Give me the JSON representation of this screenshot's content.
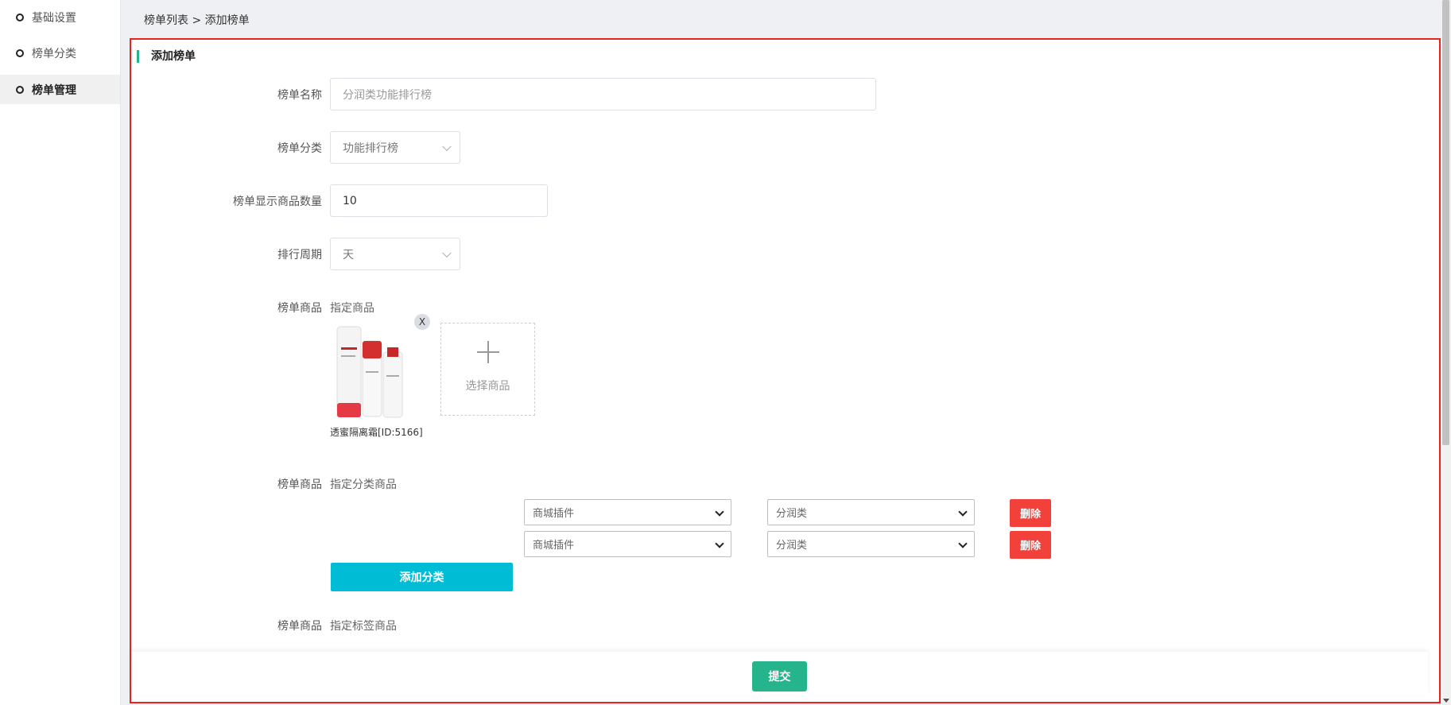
{
  "sidebar": {
    "items": [
      {
        "label": "基础设置",
        "active": false
      },
      {
        "label": "榜单分类",
        "active": false
      },
      {
        "label": "榜单管理",
        "active": true
      }
    ]
  },
  "breadcrumb": {
    "parent": "榜单列表",
    "separator": " > ",
    "current": "添加榜单"
  },
  "panel": {
    "title": "添加榜单",
    "accent_color": "#26b48d",
    "border_color": "#e8231b"
  },
  "form": {
    "name": {
      "label": "榜单名称",
      "placeholder": "分润类功能排行榜"
    },
    "category": {
      "label": "榜单分类",
      "value": "功能排行榜"
    },
    "count": {
      "label": "榜单显示商品数量",
      "value": "10"
    },
    "period": {
      "label": "排行周期",
      "value": "天"
    },
    "goods_specified": {
      "label": "榜单商品",
      "mode": "指定商品",
      "product": {
        "caption": "透蜜隔离霜[ID:5166]",
        "remove": "X"
      },
      "add_label": "选择商品"
    },
    "goods_category": {
      "label": "榜单商品",
      "mode": "指定分类商品",
      "rows": [
        {
          "plugin": "商城插件",
          "category": "分润类",
          "delete": "删除"
        },
        {
          "plugin": "商城插件",
          "category": "分润类",
          "delete": "删除"
        }
      ],
      "add_button": "添加分类"
    },
    "goods_tag": {
      "label": "榜单商品",
      "mode": "指定标签商品"
    }
  },
  "footer": {
    "submit": "提交",
    "submit_color": "#26b48d"
  },
  "colors": {
    "delete": "#f2413b",
    "add_category": "#00bcd4"
  }
}
